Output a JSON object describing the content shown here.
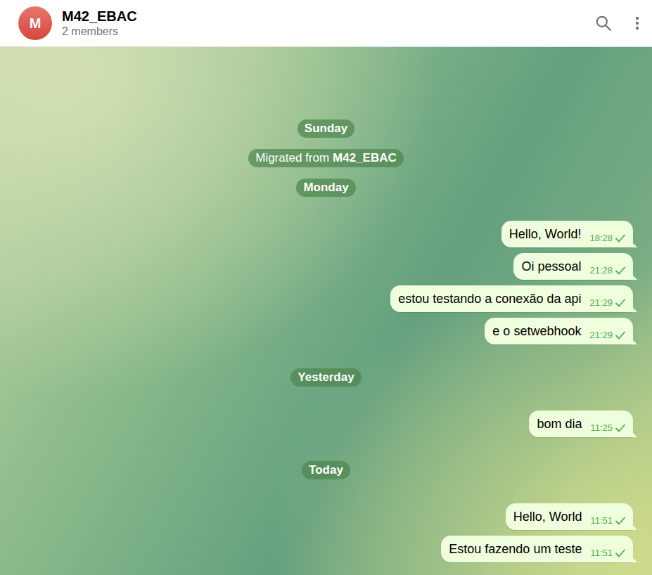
{
  "header": {
    "avatar": "M",
    "title": "M42_EBAC",
    "subtitle": "2 members"
  },
  "timeline": [
    {
      "kind": "date",
      "text": "Sunday"
    },
    {
      "kind": "service",
      "text": "Migrated from",
      "bold": "M42_EBAC"
    },
    {
      "kind": "date",
      "text": "Monday"
    },
    {
      "kind": "message",
      "text": "Hello, World!",
      "time": "18:28",
      "sent": true
    },
    {
      "kind": "message",
      "text": "Oi pessoal",
      "time": "21:28",
      "sent": true
    },
    {
      "kind": "message",
      "text": "estou testando a conexão da api",
      "time": "21:29",
      "sent": true
    },
    {
      "kind": "message",
      "text": "e o setwebhook",
      "time": "21:29",
      "sent": true
    },
    {
      "kind": "date",
      "text": "Yesterday"
    },
    {
      "kind": "message",
      "text": "bom dia",
      "time": "11:25",
      "sent": true
    },
    {
      "kind": "date",
      "text": "Today"
    },
    {
      "kind": "message",
      "text": "Hello, World",
      "time": "11:51",
      "sent": true
    },
    {
      "kind": "message",
      "text": "Estou fazendo um teste",
      "time": "11:51",
      "sent": true
    }
  ]
}
